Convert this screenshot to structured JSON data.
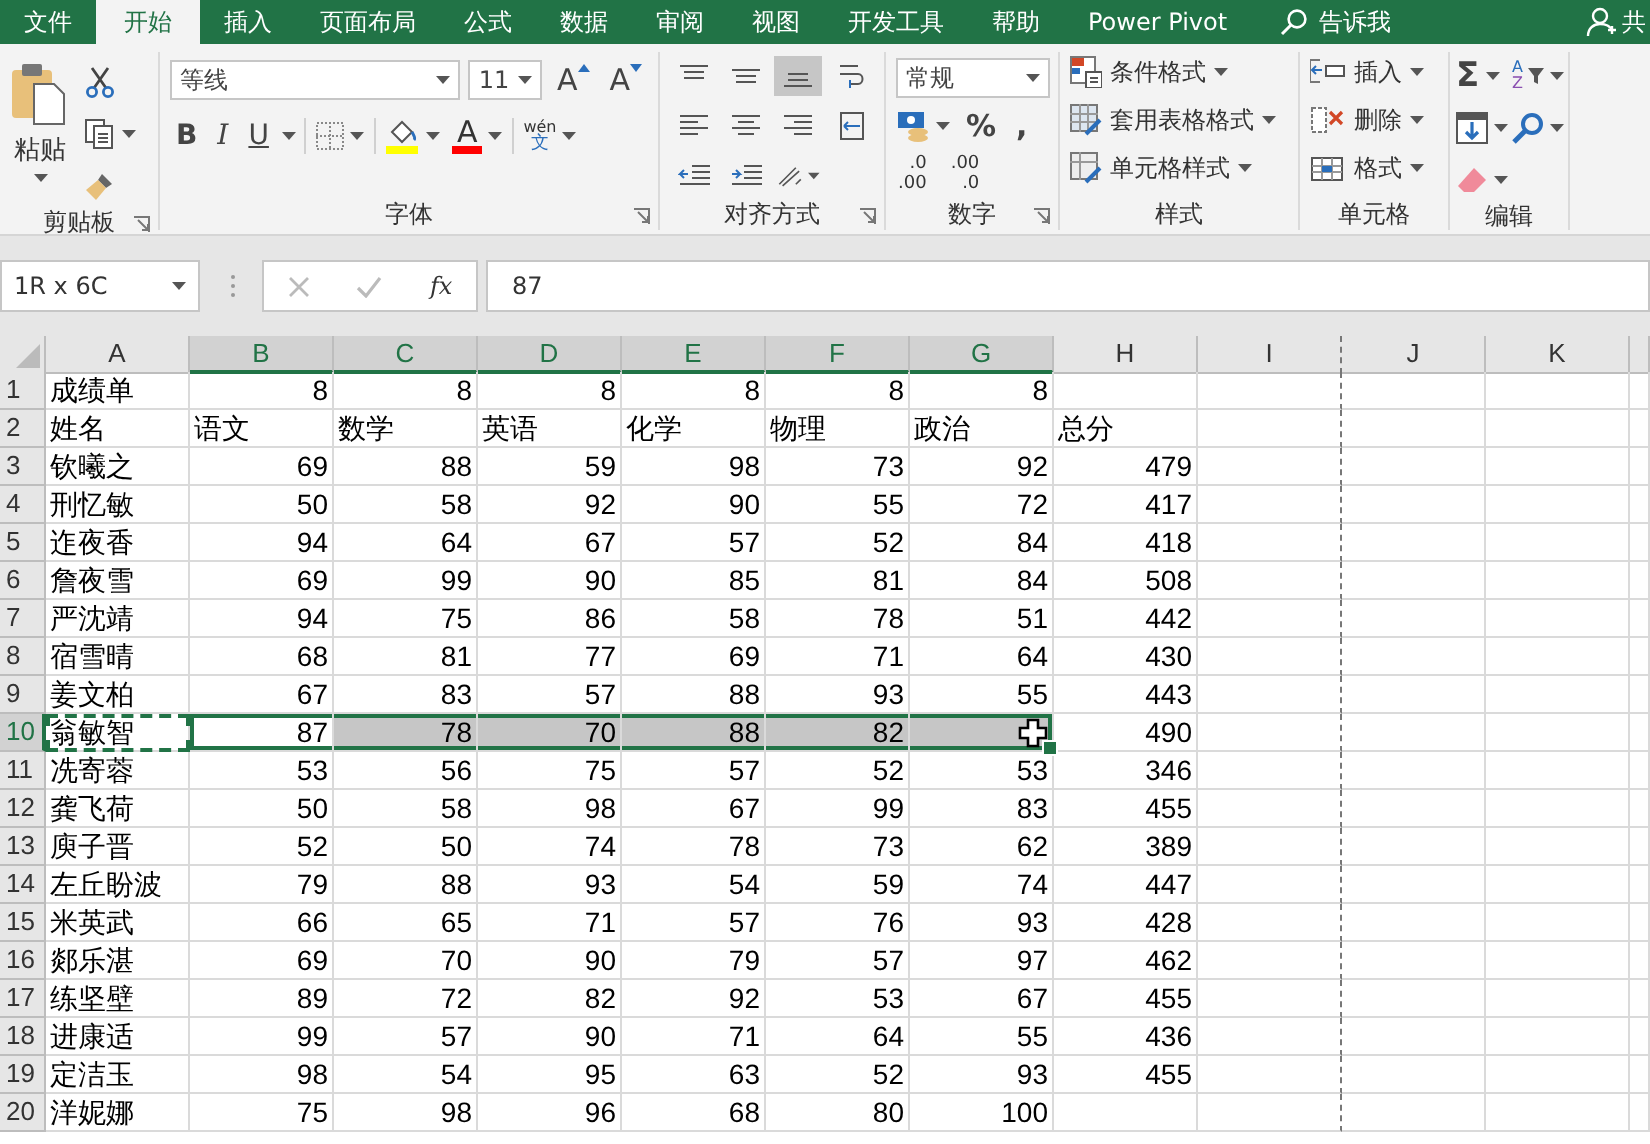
{
  "menu_tabs": [
    {
      "label": "文件",
      "selected": false
    },
    {
      "label": "开始",
      "selected": true
    },
    {
      "label": "插入",
      "selected": false
    },
    {
      "label": "页面布局",
      "selected": false
    },
    {
      "label": "公式",
      "selected": false
    },
    {
      "label": "数据",
      "selected": false
    },
    {
      "label": "审阅",
      "selected": false
    },
    {
      "label": "视图",
      "selected": false
    },
    {
      "label": "开发工具",
      "selected": false
    },
    {
      "label": "帮助",
      "selected": false
    },
    {
      "label": "Power Pivot",
      "selected": false
    }
  ],
  "tell_me": "告诉我",
  "share": "共",
  "clipboard": {
    "paste": "粘贴",
    "label": "剪贴板"
  },
  "font": {
    "name": "等线",
    "size": "11",
    "grow": "A",
    "shrink": "A",
    "bold": "B",
    "italic": "I",
    "underline": "U",
    "color_letter": "A",
    "phonetic_top": "wén",
    "phonetic_bottom": "文",
    "label": "字体"
  },
  "alignment": {
    "label": "对齐方式"
  },
  "number": {
    "format": "常规",
    "percent": "%",
    "comma": ",",
    "dec_increase": [
      ".0",
      ".00"
    ],
    "dec_decrease": [
      ".00",
      ".0"
    ],
    "label": "数字"
  },
  "styles": {
    "items": [
      {
        "label": "条件格式",
        "kind": "conditional"
      },
      {
        "label": "套用表格格式",
        "kind": "table"
      },
      {
        "label": "单元格样式",
        "kind": "cell"
      }
    ],
    "label": "样式"
  },
  "cells": {
    "items": [
      {
        "label": "插入",
        "kind": "insert"
      },
      {
        "label": "删除",
        "kind": "delete"
      },
      {
        "label": "格式",
        "kind": "format"
      }
    ],
    "label": "单元格"
  },
  "editing": {
    "sum": "Σ",
    "sort_letters": [
      "A",
      "Z"
    ],
    "label": "编辑"
  },
  "formula_bar": {
    "name_box": "1R x 6C",
    "fx": "fx",
    "value": "87"
  },
  "sheet": {
    "columns": [
      {
        "label": "A",
        "selected": false,
        "copy_marquee": true,
        "page_break": false
      },
      {
        "label": "B",
        "selected": true,
        "copy_marquee": false,
        "page_break": false
      },
      {
        "label": "C",
        "selected": true,
        "copy_marquee": false,
        "page_break": false
      },
      {
        "label": "D",
        "selected": true,
        "copy_marquee": false,
        "page_break": false
      },
      {
        "label": "E",
        "selected": true,
        "copy_marquee": false,
        "page_break": false
      },
      {
        "label": "F",
        "selected": true,
        "copy_marquee": false,
        "page_break": false
      },
      {
        "label": "G",
        "selected": true,
        "copy_marquee": false,
        "page_break": false
      },
      {
        "label": "H",
        "selected": false,
        "copy_marquee": false,
        "page_break": false
      },
      {
        "label": "I",
        "selected": false,
        "copy_marquee": false,
        "page_break": true
      },
      {
        "label": "J",
        "selected": false,
        "copy_marquee": false,
        "page_break": false
      },
      {
        "label": "K",
        "selected": false,
        "copy_marquee": false,
        "page_break": false
      }
    ],
    "rows": [
      {
        "n": "1",
        "kind": "data",
        "selected": false,
        "cells": [
          "成绩单",
          "8",
          "8",
          "8",
          "8",
          "8",
          "8",
          null
        ]
      },
      {
        "n": "2",
        "kind": "labels",
        "selected": false,
        "cells": [
          "姓名",
          "语文",
          "数学",
          "英语",
          "化学",
          "物理",
          "政治",
          "总分"
        ]
      },
      {
        "n": "3",
        "kind": "data",
        "selected": false,
        "cells": [
          "钦曦之",
          "69",
          "88",
          "59",
          "98",
          "73",
          "92",
          "479"
        ]
      },
      {
        "n": "4",
        "kind": "data",
        "selected": false,
        "cells": [
          "刑忆敏",
          "50",
          "58",
          "92",
          "90",
          "55",
          "72",
          "417"
        ]
      },
      {
        "n": "5",
        "kind": "data",
        "selected": false,
        "cells": [
          "迮夜香",
          "94",
          "64",
          "67",
          "57",
          "52",
          "84",
          "418"
        ]
      },
      {
        "n": "6",
        "kind": "data",
        "selected": false,
        "cells": [
          "詹夜雪",
          "69",
          "99",
          "90",
          "85",
          "81",
          "84",
          "508"
        ]
      },
      {
        "n": "7",
        "kind": "data",
        "selected": false,
        "cells": [
          "严沈靖",
          "94",
          "75",
          "86",
          "58",
          "78",
          "51",
          "442"
        ]
      },
      {
        "n": "8",
        "kind": "data",
        "selected": false,
        "cells": [
          "宿雪晴",
          "68",
          "81",
          "77",
          "69",
          "71",
          "64",
          "430"
        ]
      },
      {
        "n": "9",
        "kind": "data",
        "selected": false,
        "cells": [
          "姜文柏",
          "67",
          "83",
          "57",
          "88",
          "93",
          "55",
          "443"
        ]
      },
      {
        "n": "10",
        "kind": "data",
        "selected": true,
        "cells": [
          "翁敏智",
          "87",
          "78",
          "70",
          "88",
          "82",
          null,
          "490"
        ]
      },
      {
        "n": "11",
        "kind": "data",
        "selected": false,
        "cells": [
          "冼寄蓉",
          "53",
          "56",
          "75",
          "57",
          "52",
          "53",
          "346"
        ]
      },
      {
        "n": "12",
        "kind": "data",
        "selected": false,
        "cells": [
          "龚飞荷",
          "50",
          "58",
          "98",
          "67",
          "99",
          "83",
          "455"
        ]
      },
      {
        "n": "13",
        "kind": "data",
        "selected": false,
        "cells": [
          "庾子晋",
          "52",
          "50",
          "74",
          "78",
          "73",
          "62",
          "389"
        ]
      },
      {
        "n": "14",
        "kind": "data",
        "selected": false,
        "cells": [
          "左丘盼波",
          "79",
          "88",
          "93",
          "54",
          "59",
          "74",
          "447"
        ]
      },
      {
        "n": "15",
        "kind": "data",
        "selected": false,
        "cells": [
          "米英武",
          "66",
          "65",
          "71",
          "57",
          "76",
          "93",
          "428"
        ]
      },
      {
        "n": "16",
        "kind": "data",
        "selected": false,
        "cells": [
          "郯乐湛",
          "69",
          "70",
          "90",
          "79",
          "57",
          "97",
          "462"
        ]
      },
      {
        "n": "17",
        "kind": "data",
        "selected": false,
        "cells": [
          "练坚壁",
          "89",
          "72",
          "82",
          "92",
          "53",
          "67",
          "455"
        ]
      },
      {
        "n": "18",
        "kind": "data",
        "selected": false,
        "cells": [
          "进康适",
          "99",
          "57",
          "90",
          "71",
          "64",
          "55",
          "436"
        ]
      },
      {
        "n": "19",
        "kind": "data",
        "selected": false,
        "cells": [
          "定洁玉",
          "98",
          "54",
          "95",
          "63",
          "52",
          "93",
          "455"
        ]
      },
      {
        "n": "20",
        "kind": "data",
        "selected": false,
        "cells": [
          "洋妮娜",
          "75",
          "98",
          "96",
          "68",
          "80",
          "100",
          null
        ]
      }
    ]
  }
}
